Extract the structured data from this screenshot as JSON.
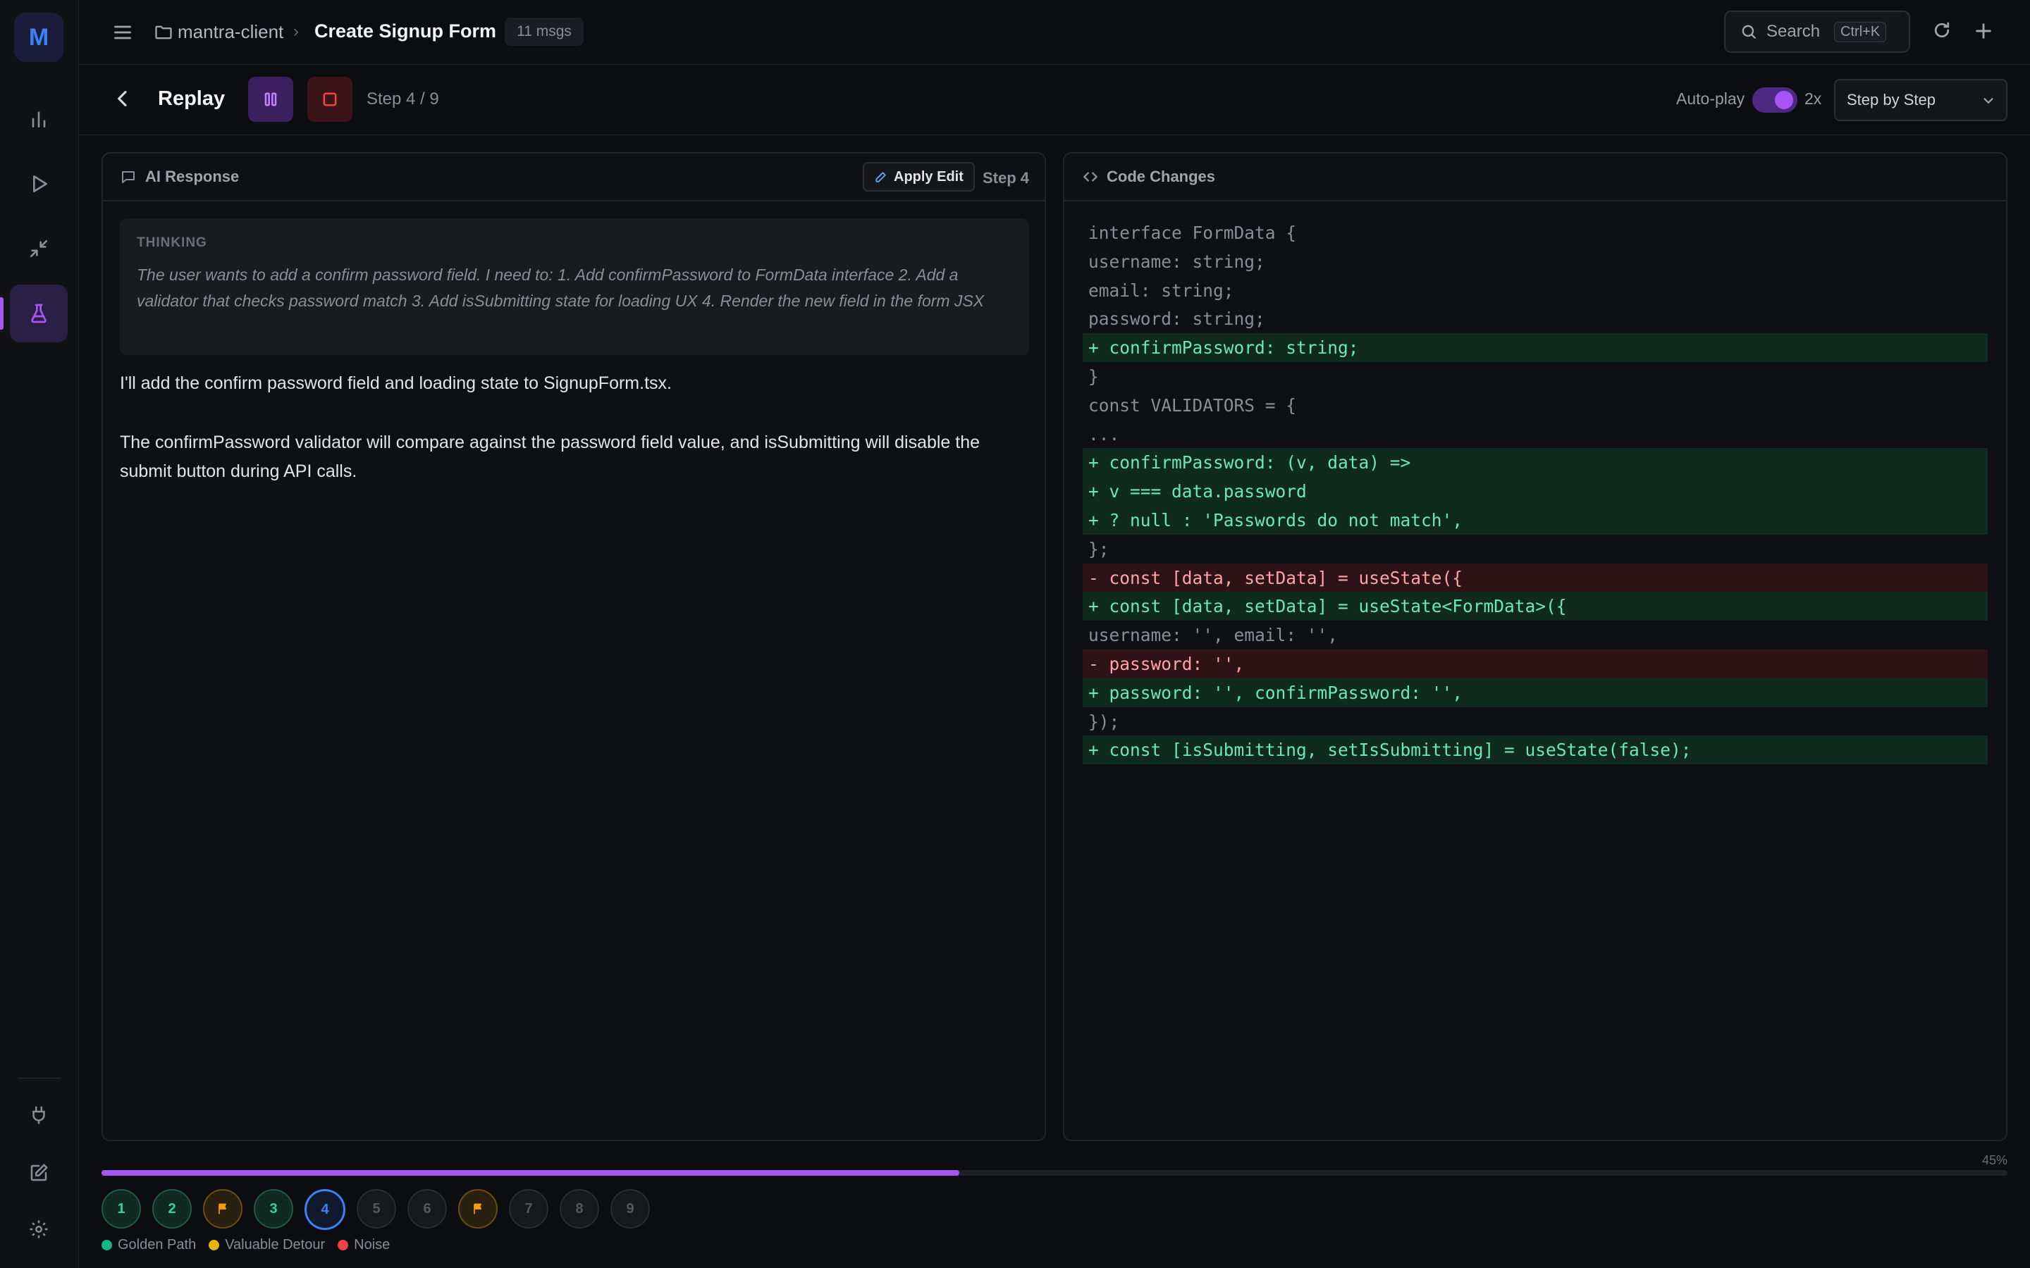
{
  "app": {
    "logo_letter": "M",
    "accent": "#a855f7"
  },
  "breadcrumb": {
    "project": "mantra-client",
    "conversation": "Create Signup Form",
    "msg_count": "11 msgs"
  },
  "search": {
    "label": "Search",
    "shortcut": "Ctrl+K"
  },
  "replay": {
    "title": "Replay",
    "step_label": "Step 4 / 9",
    "autoplay_label": "Auto-play",
    "autoplay_on": true,
    "speed": "2x",
    "mode": "Step by Step"
  },
  "ai_panel": {
    "title": "AI Response",
    "apply_edit": "Apply Edit",
    "step_badge": "Step 4",
    "thinking_label": "THINKING",
    "thinking_text": "The user wants to add a confirm password field. I need to: 1. Add confirmPassword to FormData interface 2. Add a validator that checks password match 3. Add isSubmitting state for loading UX 4. Render the new field in the form JSX",
    "paragraphs": [
      "I'll add the confirm password field and loading state to SignupForm.tsx.",
      "The confirmPassword validator will compare against the password field value, and isSubmitting will disable the submit button during API calls."
    ]
  },
  "code_panel": {
    "title": "Code Changes",
    "lines": [
      {
        "type": "ctx",
        "text": "interface FormData {"
      },
      {
        "type": "ctx",
        "text": "username: string;"
      },
      {
        "type": "ctx",
        "text": "email: string;"
      },
      {
        "type": "ctx",
        "text": "password: string;"
      },
      {
        "type": "add",
        "text": "+ confirmPassword: string;"
      },
      {
        "type": "ctx",
        "text": "}"
      },
      {
        "type": "ctx",
        "text": "const VALIDATORS = {"
      },
      {
        "type": "ctx",
        "text": "..."
      },
      {
        "type": "add",
        "text": "+ confirmPassword: (v, data) =>"
      },
      {
        "type": "add",
        "text": "+ v === data.password"
      },
      {
        "type": "add",
        "text": "+ ? null : 'Passwords do not match',"
      },
      {
        "type": "ctx",
        "text": "};"
      },
      {
        "type": "del",
        "text": "- const [data, setData] = useState({"
      },
      {
        "type": "add",
        "text": "+ const [data, setData] = useState<FormData>({"
      },
      {
        "type": "ctx",
        "text": "username: '', email: '',"
      },
      {
        "type": "del",
        "text": "- password: '',"
      },
      {
        "type": "add",
        "text": "+ password: '', confirmPassword: '',"
      },
      {
        "type": "ctx",
        "text": "});"
      },
      {
        "type": "add",
        "text": "+ const [isSubmitting, setIsSubmitting] = useState(false);"
      }
    ]
  },
  "progress": {
    "percent_label": "45%",
    "fraction": 0.45
  },
  "timeline": [
    {
      "label": "1",
      "kind": "golden"
    },
    {
      "label": "2",
      "kind": "golden"
    },
    {
      "label": "",
      "kind": "flag"
    },
    {
      "label": "3",
      "kind": "golden"
    },
    {
      "label": "4",
      "kind": "current"
    },
    {
      "label": "5",
      "kind": "pending"
    },
    {
      "label": "6",
      "kind": "pending"
    },
    {
      "label": "",
      "kind": "flag"
    },
    {
      "label": "7",
      "kind": "pending"
    },
    {
      "label": "8",
      "kind": "pending"
    },
    {
      "label": "9",
      "kind": "pending"
    }
  ],
  "legend": [
    {
      "label": "Golden Path",
      "color": "#10b981"
    },
    {
      "label": "Valuable Detour",
      "color": "#eab308"
    },
    {
      "label": "Noise",
      "color": "#ef4444"
    }
  ]
}
